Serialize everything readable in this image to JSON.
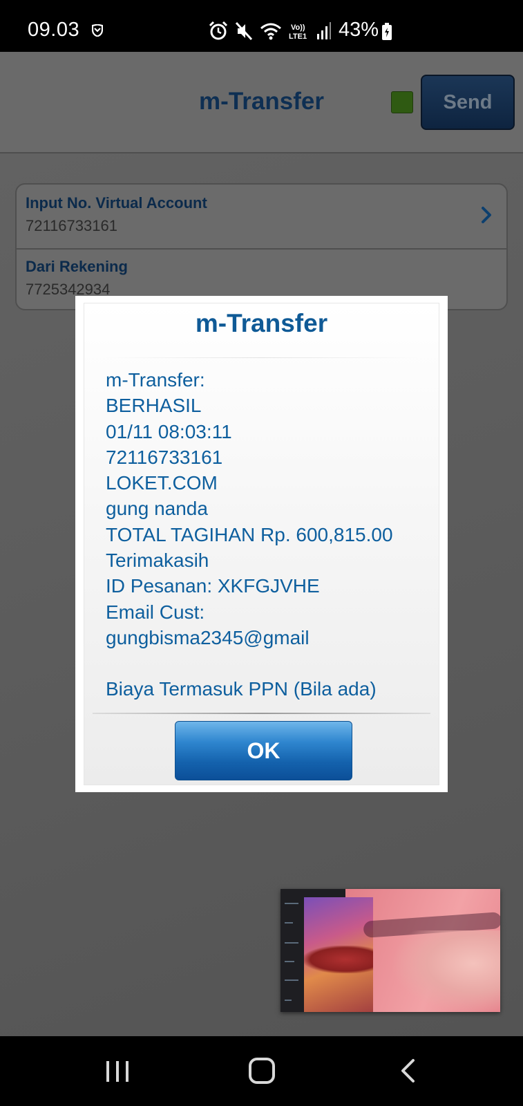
{
  "status_bar": {
    "time": "09.03",
    "battery": "43%",
    "icons": [
      "shield-icon",
      "alarm-icon",
      "mute-icon",
      "wifi-icon",
      "volte-icon",
      "signal-icon",
      "battery-charging-icon"
    ]
  },
  "header": {
    "title": "m-Transfer",
    "send_label": "Send",
    "indicator_color": "#2f5a12"
  },
  "form": {
    "rows": [
      {
        "label": "Input No. Virtual Account",
        "value": "72116733161"
      },
      {
        "label": "Dari Rekening",
        "value": "7725342934"
      }
    ]
  },
  "dialog": {
    "title": "m-Transfer",
    "lines": [
      "m-Transfer:",
      "BERHASIL",
      "01/11 08:03:11",
      "72116733161",
      "LOKET.COM",
      "gung nanda",
      "TOTAL TAGIHAN Rp. 600,815.00",
      "Terimakasih",
      "ID Pesanan: XKFGJVHE",
      "Email Cust:",
      "gungbisma2345@gmail"
    ],
    "footer": "Biaya Termasuk PPN (Bila ada)",
    "ok_label": "OK"
  },
  "colors": {
    "accent_blue": "#0f5a96",
    "button_blue": "#1462ad",
    "header_navy": "#0e2f53"
  }
}
